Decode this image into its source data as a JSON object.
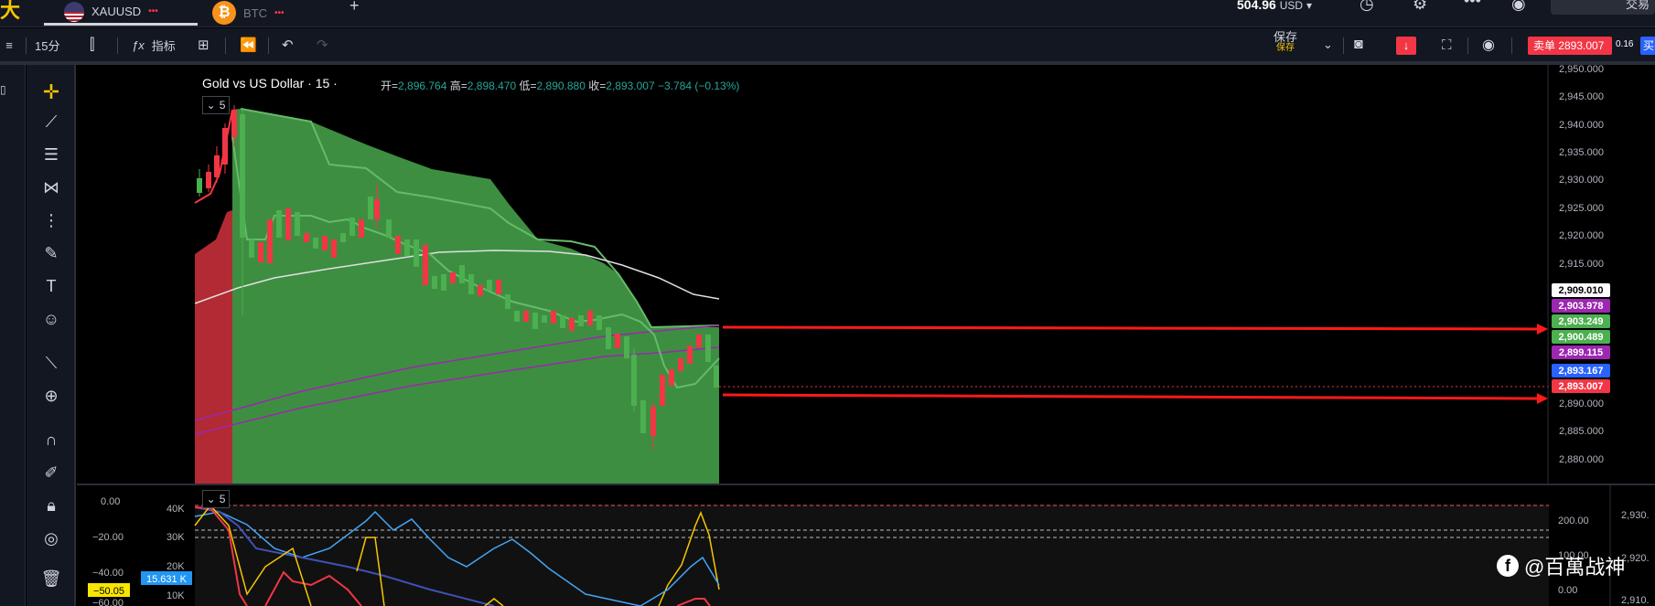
{
  "header": {
    "brand_text": "大",
    "tabs": [
      {
        "label": "XAUUSD",
        "badge": "•••"
      },
      {
        "label": "BTC",
        "badge": "•••"
      }
    ],
    "add_tab": "+",
    "balance_value": "504.96",
    "balance_currency": "USD",
    "right_box": "交易"
  },
  "toolbar": {
    "interval": "15分",
    "indicators": "指标",
    "save_label": "保存",
    "save_sub": "保存",
    "download_glyph": "↓",
    "sell_label": "卖单 2893.007",
    "spread": "0.16",
    "buy_label": "买"
  },
  "chart": {
    "symbol_title": "Gold vs US Dollar · 15 ·",
    "open_label": "开=",
    "open_value": "2,896.764",
    "high_label": "高=",
    "high_value": "2,898.470",
    "low_label": "低=",
    "low_value": "2,890.880",
    "close_label": "收=",
    "close_value": "2,893.007",
    "change_value": "−3.784 (−0.13%)",
    "collapse_count_main": "5",
    "collapse_count_sub": "5",
    "price_axis": [
      "2,950.000",
      "2,945.000",
      "2,940.000",
      "2,935.000",
      "2,930.000",
      "2,925.000",
      "2,920.000",
      "2,915.000",
      "2,890.000",
      "2,885.000",
      "2,880.000"
    ],
    "price_badges": [
      {
        "value": "2,909.010",
        "bg": "#ffffff",
        "fg": "#000000"
      },
      {
        "value": "2,903.978",
        "bg": "#9c27b0",
        "fg": "#ffffff"
      },
      {
        "value": "2,903.249",
        "bg": "#4caf50",
        "fg": "#ffffff"
      },
      {
        "value": "2,900.489",
        "bg": "#4caf50",
        "fg": "#ffffff"
      },
      {
        "value": "2,899.115",
        "bg": "#9c27b0",
        "fg": "#ffffff"
      },
      {
        "value": "2,893.167",
        "bg": "#2962ff",
        "fg": "#ffffff"
      },
      {
        "value": "2,893.007",
        "bg": "#f23645",
        "fg": "#ffffff"
      }
    ],
    "sub_left_axis": [
      "0.00",
      "−20.00",
      "−40.00",
      "−60.00"
    ],
    "sub_left_badge": "−50.05",
    "vol_axis": [
      "40K",
      "30K",
      "20K",
      "10K"
    ],
    "vol_badge": "15.631 K",
    "sub_right_axis": [
      "200.00",
      "100.00",
      "0.00"
    ],
    "far_right_axis": [
      "2,930.",
      "2,920.",
      "2,910."
    ]
  },
  "watermark": "@百萬战神",
  "colors": {
    "green_fill": "#3e8e41",
    "red": "#f23645",
    "accent_yellow": "#f7c600"
  }
}
